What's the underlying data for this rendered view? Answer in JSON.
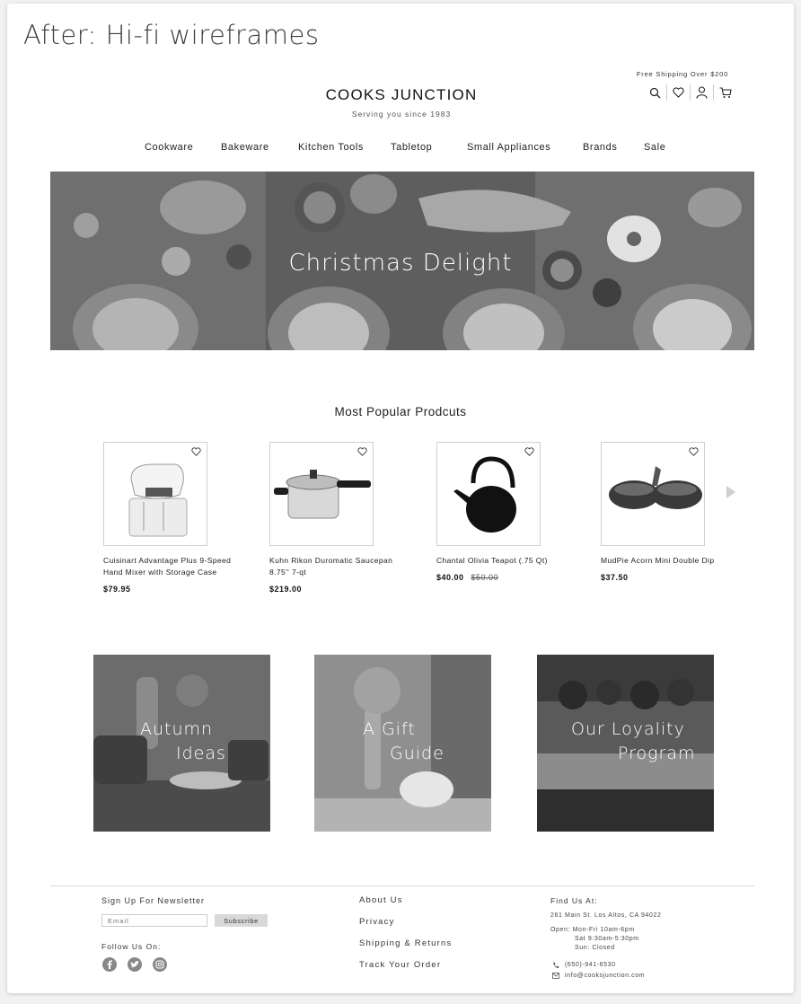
{
  "caption": "After: Hi-fi wireframes",
  "header": {
    "shipping_note": "Free Shipping Over $200",
    "brand": "COOKS JUNCTION",
    "tagline": "Serving you since 1983",
    "icons": [
      "search-icon",
      "heart-icon",
      "user-icon",
      "cart-icon"
    ]
  },
  "nav": {
    "items": [
      "Cookware",
      "Bakeware",
      "Kitchen Tools",
      "Tabletop",
      "Small Appliances",
      "Brands",
      "Sale"
    ]
  },
  "hero": {
    "title": "Christmas Delight"
  },
  "popular": {
    "title": "Most Popular Prodcuts",
    "products": [
      {
        "name": "Cuisinart Advantage Plus 9-Speed Hand Mixer with Storage Case",
        "price": "$79.95",
        "old_price": ""
      },
      {
        "name": "Kuhn Rikon Duromatic Saucepan 8.75'' 7-qt",
        "price": "$219.00",
        "old_price": ""
      },
      {
        "name": "Chantal Olivia Teapot (.75 Qt)",
        "price": "$40.00",
        "old_price": "$50.00"
      },
      {
        "name": "MudPie Acorn Mini Double Dip",
        "price": "$37.50",
        "old_price": ""
      }
    ]
  },
  "tiles": {
    "autumn_line1": "Autumn",
    "autumn_line2": "Ideas",
    "gift_line1": "A Gift",
    "gift_line2": "Guide",
    "loyalty_line1": "Our Loyality",
    "loyalty_line2": "Program"
  },
  "footer": {
    "newsletter_label": "Sign Up For Newsletter",
    "email_placeholder": "Email",
    "subscribe_label": "Subscribe",
    "follow_label": "Follow Us On:",
    "social_icons": [
      "facebook-icon",
      "twitter-icon",
      "instagram-icon"
    ],
    "links": [
      "About Us",
      "Privacy",
      "Shipping & Returns",
      "Track Your Order"
    ],
    "find_label": "Find Us At:",
    "address": "261 Main St. Los Altos, CA 94022",
    "hours_1": "Open: Mon-Fri 10am-6pm",
    "hours_2": "Sat  9:30am-5:30pm",
    "hours_3": "Sun: Closed",
    "phone": "(650)-941-6530",
    "email": "info@cooksjunction.com"
  }
}
